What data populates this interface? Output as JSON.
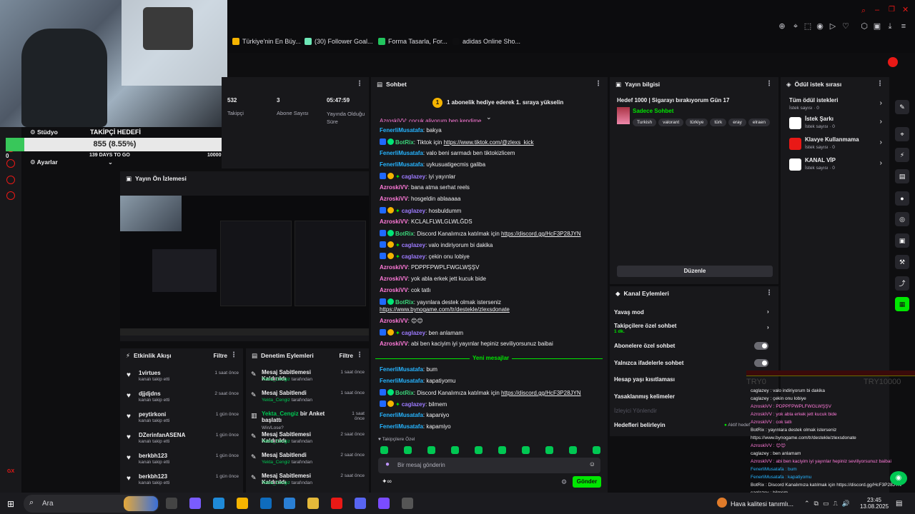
{
  "bookmarks": [
    "Türkiye'nin En Büy...",
    "(30) Follower Goal...",
    "Forma Tasarla, For...",
    "adidas Online Sho..."
  ],
  "left": {
    "studio": "Stüdyo",
    "settings": "Ayarlar",
    "goal_title": "TAKİPÇİ HEDEFİ",
    "goal_value": "855 (8.55%)",
    "goal_progress": 0.0855,
    "goal_min": "0",
    "goal_max": "10000",
    "goal_days": "139 DAYS TO GO"
  },
  "stats": [
    {
      "value": "532",
      "label": "Takipçi"
    },
    {
      "value": "3",
      "label": "Abone Sayısı"
    },
    {
      "value": "05:47:59",
      "label": "Yayında Olduğu Süre"
    }
  ],
  "preview": {
    "title": "Yayın Ön İzlemesi"
  },
  "activity": {
    "title": "Etkinlik Akışı",
    "filter": "Filtre",
    "items": [
      {
        "name": "1virtues",
        "sub": "kanalı takip etti",
        "time": "1 saat önce"
      },
      {
        "name": "djjdjdns",
        "sub": "kanalı takip etti",
        "time": "2 saat önce"
      },
      {
        "name": "peytirkoni",
        "sub": "kanalı takip etti",
        "time": "1 gün önce"
      },
      {
        "name": "DZerinfanASENA",
        "sub": "kanalı takip etti",
        "time": "1 gün önce"
      },
      {
        "name": "berkbh123",
        "sub": "kanalı takip etti",
        "time": "1 gün önce"
      },
      {
        "name": "berkbh123",
        "sub": "kanalı takip etti",
        "time": "1 gün önce"
      }
    ]
  },
  "moderation": {
    "title": "Denetim Eylemleri",
    "filter": "Filtre",
    "items": [
      {
        "name": "Mesaj Sabitlemesi Kaldırıldı",
        "sub": "Yekta_Cengiz",
        "suffix": "tarafından",
        "time": "1 saat önce"
      },
      {
        "name": "Mesaj Sabitlendi",
        "sub": "Yekta_Cengiz",
        "suffix": "tarafından",
        "time": "1 saat önce"
      },
      {
        "name": "bir Anket başlattı",
        "sub": "Yekta_Cengiz",
        "suffix": "Win/Lose?",
        "time": "1 saat önce"
      },
      {
        "name": "Mesaj Sabitlemesi Kaldırıldı",
        "sub": "Yekta_Cengiz",
        "suffix": "tarafından",
        "time": "2 saat önce"
      },
      {
        "name": "Mesaj Sabitlendi",
        "sub": "Yekta_Cengiz",
        "suffix": "tarafından",
        "time": "2 saat önce"
      },
      {
        "name": "Mesaj Sabitlemesi Kaldırıldı",
        "sub": "Yekta_Cengiz",
        "suffix": "tarafından",
        "time": "2 saat önce"
      }
    ]
  },
  "chat": {
    "title": "Sohbet",
    "banner": "1 abonelik hediye ederek 1. sıraya yükselin",
    "partial_top": "AzroskiVV: çocuk aliyorum ben kendime",
    "new_messages": "Yeni mesajlar",
    "emote_label": "Takipçilere Özel",
    "placeholder": "Bir mesaj gönderin",
    "send": "Gönder",
    "lines": [
      {
        "user": "FenerliMusatafa",
        "text": ": bakya",
        "cls": "user-green"
      },
      {
        "user": "BotRix",
        "text": ": Tiktok için ",
        "link": "https://www.tiktok.com/@zlexs_kick",
        "cls": "u4"
      },
      {
        "user": "FenerliMusatafa",
        "text": ": valo beni sarmadı ben tiktokizlicem",
        "cls": "user-green"
      },
      {
        "user": "FenerliMusatafa",
        "text": ": uykusuatigecmis galiba",
        "cls": "user-green"
      },
      {
        "user": "caglazey",
        "text": ": iyi yayınlar",
        "cls": "u3"
      },
      {
        "user": "AzroskiVV",
        "text": ": bana atma serhat reels",
        "cls": "u1"
      },
      {
        "user": "AzroskiVV",
        "text": ": hosgeldin ablaaaaa",
        "cls": "u1"
      },
      {
        "user": "caglazey",
        "text": ": hosbuldumm",
        "cls": "u3"
      },
      {
        "user": "AzroskiVV",
        "text": ": KCLALFLWLGLWLĞDS",
        "cls": "u1"
      },
      {
        "user": "BotRix",
        "text": ": Discord Kanalımıza katılmak için ",
        "link": "https://discord.gg/HcF3P28JYN",
        "cls": "u4"
      },
      {
        "user": "caglazey",
        "text": ": valo indiriyorum bi dakika",
        "cls": "u3"
      },
      {
        "user": "caglazey",
        "text": ": çekin onu lobiye",
        "cls": "u3"
      },
      {
        "user": "AzroskiVV",
        "text": ": PDPPFPWPLFWGLWŞŞV",
        "cls": "u1"
      },
      {
        "user": "AzroskiVV",
        "text": ": yok abla erkek jett kucuk bide",
        "cls": "u1"
      },
      {
        "user": "AzroskiVV",
        "text": ": cok tatlı",
        "cls": "u1"
      },
      {
        "user": "BotRix",
        "text": ": yayınlara destek olmak isterseniz",
        "link": "https://www.bynogame.com/tr/destekle/zlexsdonate",
        "cls": "u4"
      },
      {
        "user": "AzroskiVV",
        "text": ": 😊😊",
        "cls": "u1"
      },
      {
        "user": "caglazey",
        "text": ": ben anlamam",
        "cls": "u3"
      },
      {
        "user": "AzroskiVV",
        "text": ": abi ben kaciyim iyi yayınlar hepiniz seviliyorsunuz baibai",
        "cls": "u1"
      }
    ],
    "after": [
      {
        "user": "FenerliMusatafa",
        "text": ": bum",
        "cls": "user-green"
      },
      {
        "user": "FenerliMusatafa",
        "text": ": kapatiyomu",
        "cls": "user-green"
      },
      {
        "user": "BotRix",
        "text": ": Discord Kanalımıza katılmak için ",
        "link": "https://discord.gg/HcF3P28JYN",
        "cls": "u4"
      },
      {
        "user": "caglazey",
        "text": ": bilmem",
        "cls": "u3"
      },
      {
        "user": "FenerliMusatafa",
        "text": ": kapaniyo",
        "cls": "user-green"
      },
      {
        "user": "FenerliMusatafa",
        "text": ": kapamiyo",
        "cls": "user-green"
      }
    ]
  },
  "streaminfo": {
    "title": "Yayın bilgisi",
    "stream_title": "Hedef 1000 | Sigarayı bırakıyorum Gün 17",
    "category": "Sadece Sohbet",
    "tags": [
      "Turkish",
      "valorant",
      "türkiye",
      "türk",
      "eray",
      "elraen"
    ],
    "edit": "Düzenle"
  },
  "channel_actions": {
    "title": "Kanal Eylemleri",
    "slow": "Yavaş mod",
    "followers": "Takipçilere özel sohbet",
    "followers_sub": "1 dk.",
    "subs": "Abonelere özel sohbet",
    "emotes": "Yalnızca ifadelerle sohbet",
    "age": "Hesap yaşı kısıtlaması",
    "banned": "Yasaklanmış kelimeler",
    "viewer": "İzleyici Yönlendir",
    "goals": "Hedefleri belirleyin",
    "active": "Aktif hedef"
  },
  "rewards": {
    "title": "Ödül istek sırası",
    "all": "Tüm ödül istekleri",
    "all_sub": "İstek sayısı · 0",
    "items": [
      {
        "name": "İstek Şarkı",
        "sub": "İstek sayısı · 0",
        "color": "#ffffff"
      },
      {
        "name": "Klavye Kullanmama",
        "sub": "İstek sayısı · 0",
        "color": "#e91916"
      },
      {
        "name": "KANAL VİP",
        "sub": "İstek sayısı · 0",
        "color": "#ffffff"
      }
    ]
  },
  "overlay": {
    "lines": [
      "caglazey : valo indiriyorum bi dakika",
      "caglazey : çekin onu lobiye",
      "AzroskiVV : PDPPFPWPLFWGLWŞŞV",
      "AzroskiVV : yok abla erkek jett kucuk bide",
      "AzroskiVV : cok tatlı",
      "BotRix : yayınlara destek olmak isterseniz",
      "https://www.bynogame.com/tr/destekle/zlexsdonate",
      "AzroskiVV : 😊😊",
      "caglazey : ben anlamam",
      "AzroskiVV : abi ben kaciyim iyi yayınlar hepiniz seviliyorsunuz baibai",
      "FenerliMusatafa : bum",
      "FenerliMusatafa : kapatiyomu",
      "BotRix : Discord Kanalımıza katılmak için https://discord.gg/HcF3P28JYN",
      "caglazey : bilmem",
      "FenerliMusatafa : kapaniyo",
      "FenerliMusatafa : kapamiyo"
    ],
    "try_left": "TRY0",
    "try_right": "TRY10000"
  },
  "taskbar": {
    "search": "Ara",
    "weather": "Hava kalitesi tanımlı...",
    "time": "23:45",
    "date": "13.08.2025"
  },
  "colors": {
    "accent": "#00e701",
    "bg": "#0e0e10",
    "panel": "#18181b"
  }
}
